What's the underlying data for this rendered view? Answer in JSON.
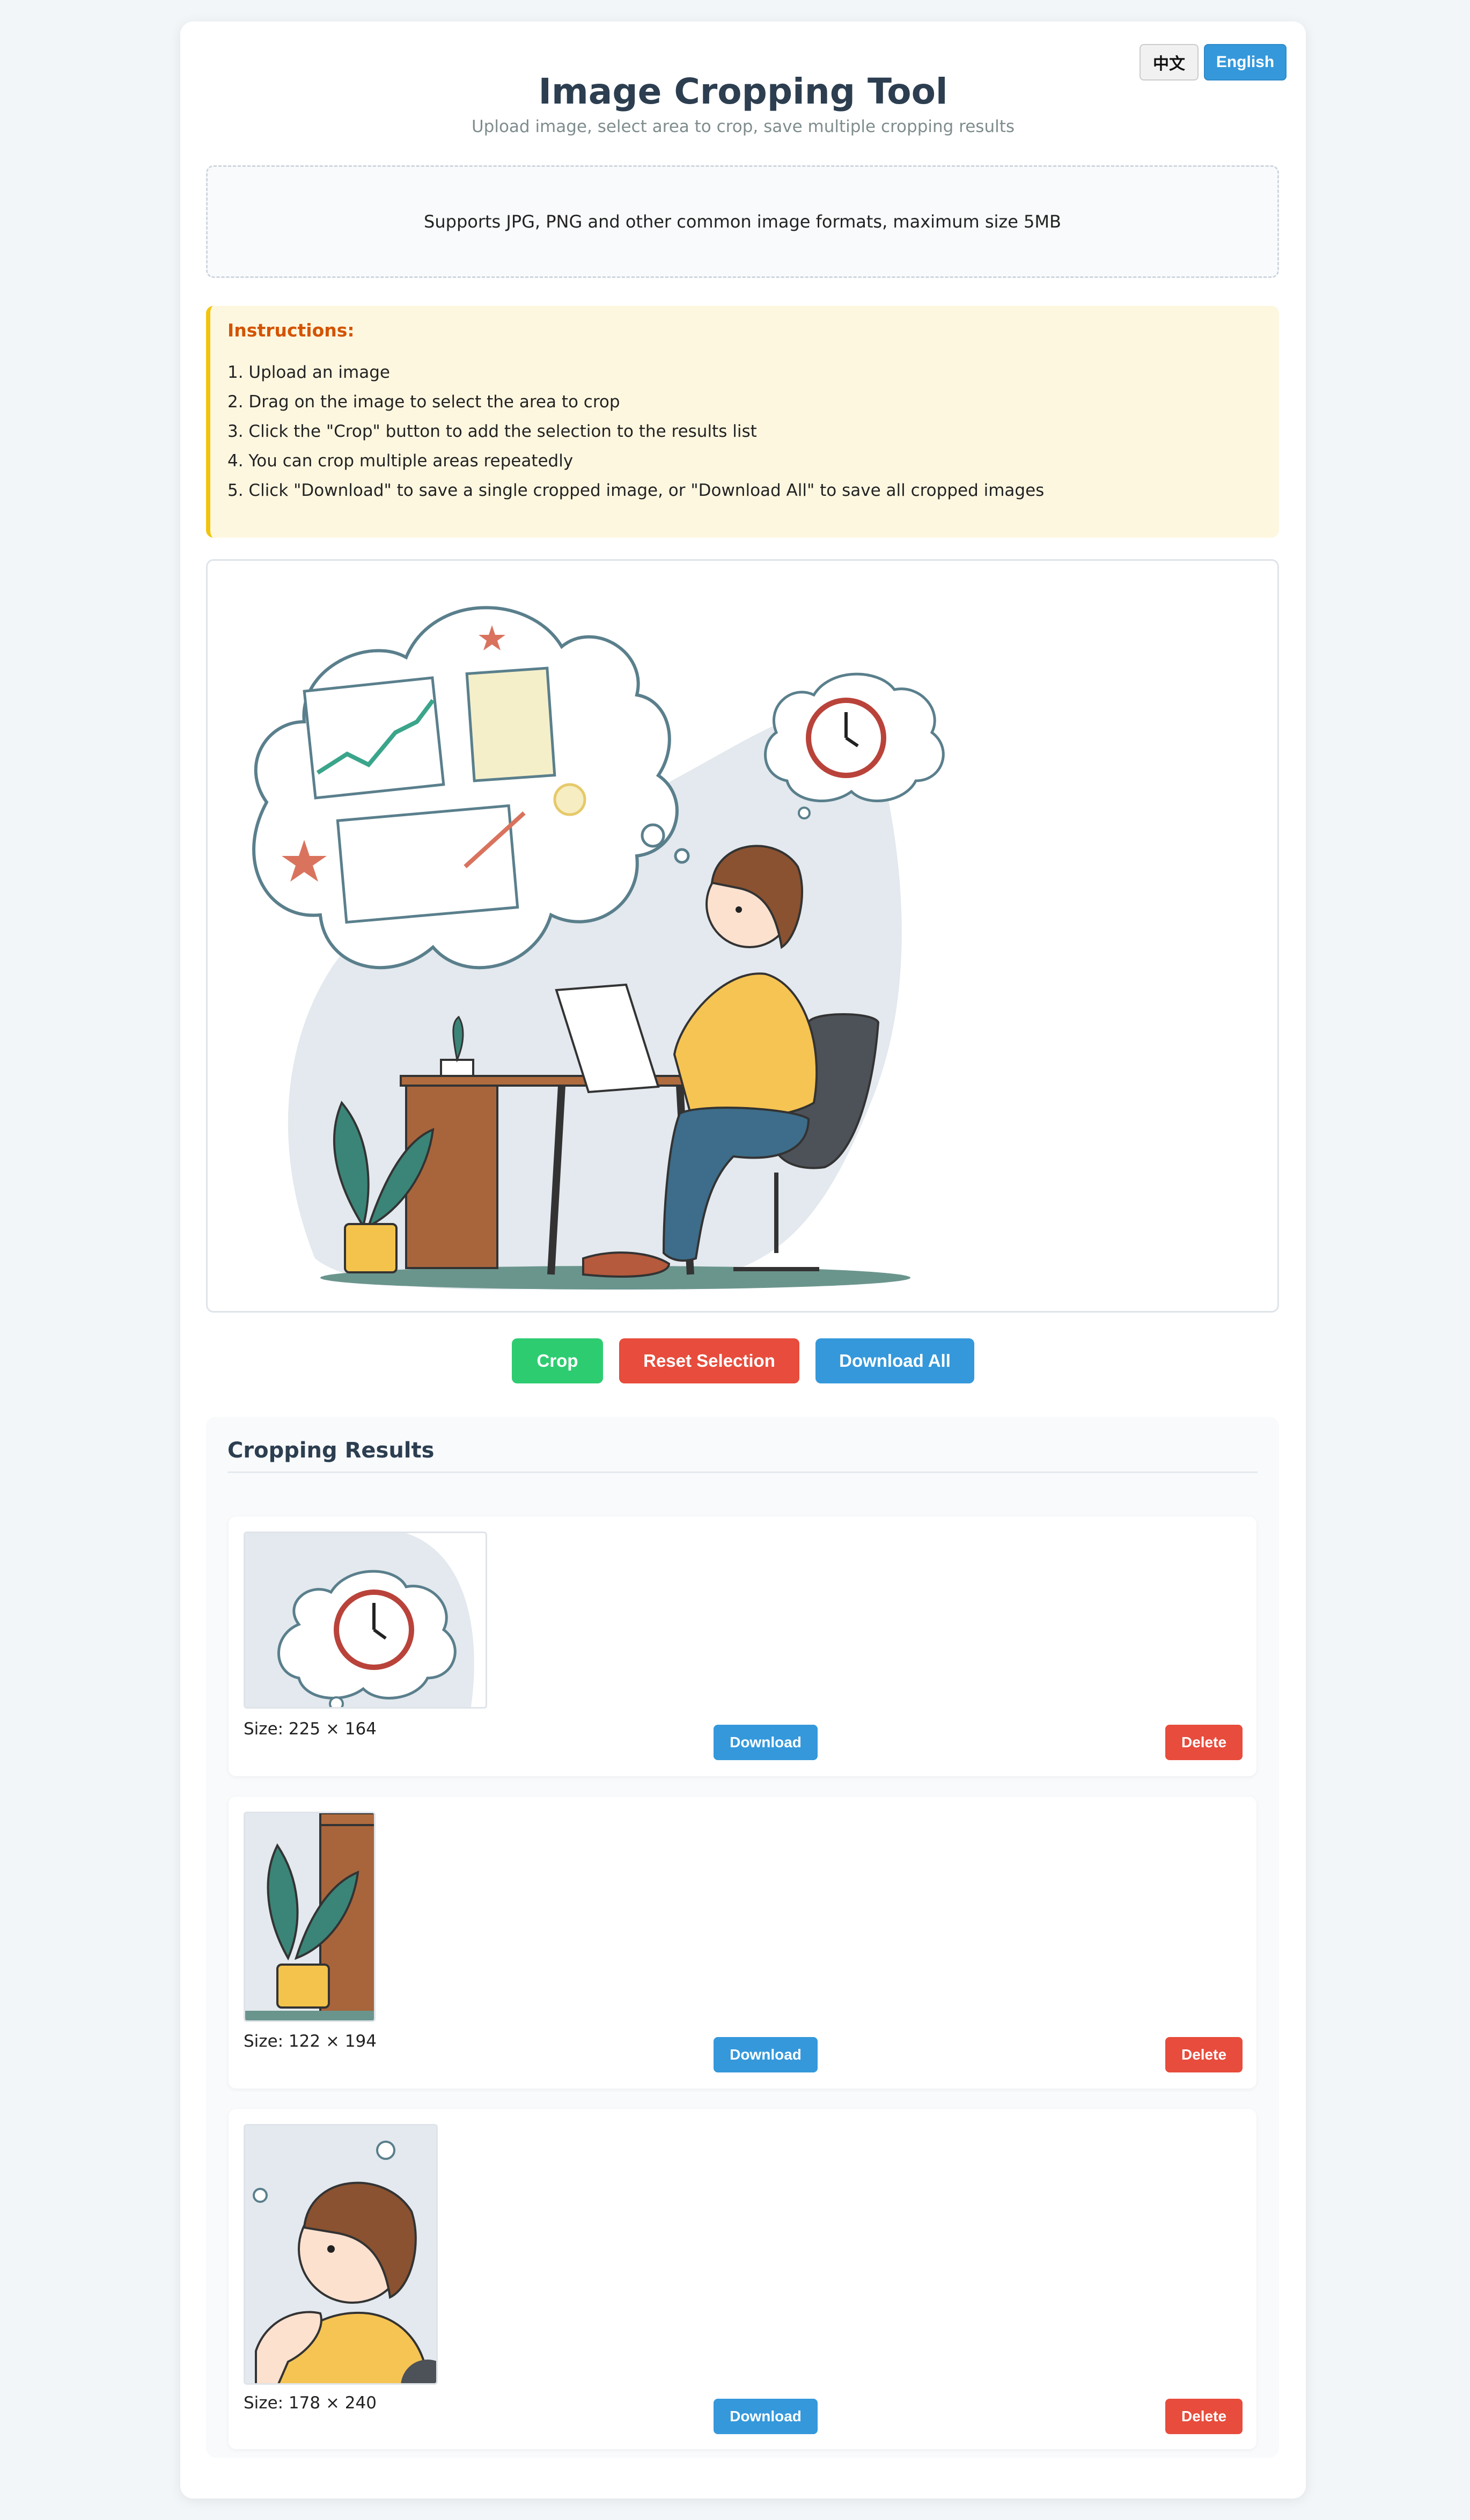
{
  "header": {
    "lang_zh": "中文",
    "lang_en": "English",
    "title": "Image Cropping Tool",
    "subtitle": "Upload image, select area to crop, save multiple cropping results"
  },
  "upload": {
    "hint": "Supports JPG, PNG and other common image formats, maximum size 5MB"
  },
  "instructions": {
    "title": "Instructions:",
    "items": [
      "1. Upload an image",
      "2. Drag on the image to select the area to crop",
      "3. Click the \"Crop\" button to add the selection to the results list",
      "4. You can crop multiple areas repeatedly",
      "5. Click \"Download\" to save a single cropped image, or \"Download All\" to save all cropped images"
    ]
  },
  "actions": {
    "crop": "Crop",
    "reset": "Reset Selection",
    "download_all": "Download All"
  },
  "results": {
    "title": "Cropping Results",
    "items": [
      {
        "size": "Size: 225 × 164",
        "download": "Download",
        "delete": "Delete"
      },
      {
        "size": "Size: 122 × 194",
        "download": "Download",
        "delete": "Delete"
      },
      {
        "size": "Size: 178 × 240",
        "download": "Download",
        "delete": "Delete"
      }
    ]
  },
  "colors": {
    "primary": "#3598db",
    "success": "#2ecc71",
    "danger": "#e74c3c",
    "warning_border": "#f1c40f",
    "warning_title": "#d35400",
    "heading": "#2c3e50"
  }
}
